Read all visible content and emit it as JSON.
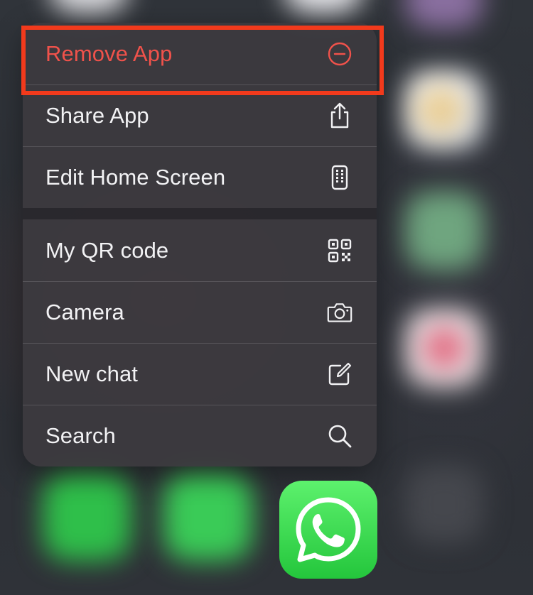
{
  "menu": {
    "top_group": [
      {
        "label": "Remove App",
        "icon": "minus-circle-icon",
        "destructive": true
      },
      {
        "label": "Share App",
        "icon": "share-icon"
      },
      {
        "label": "Edit Home Screen",
        "icon": "phone-grid-icon"
      }
    ],
    "bottom_group": [
      {
        "label": "My QR code",
        "icon": "qr-code-icon"
      },
      {
        "label": "Camera",
        "icon": "camera-icon"
      },
      {
        "label": "New chat",
        "icon": "compose-icon"
      },
      {
        "label": "Search",
        "icon": "search-icon"
      }
    ]
  },
  "colors": {
    "destructive": "#f0524b",
    "highlight": "#f23a1c",
    "whatsapp_green": "#25d366"
  },
  "app_icon": {
    "icon": "whatsapp-icon"
  }
}
